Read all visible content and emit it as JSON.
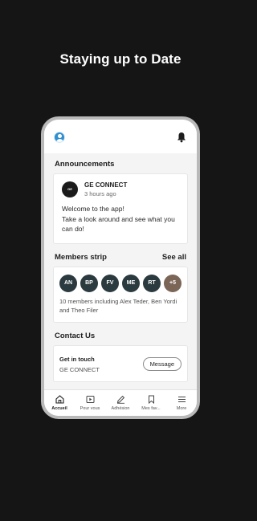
{
  "headline": "Staying up to Date",
  "topbar": {
    "avatar_icon": "user-avatar-icon",
    "notifications_icon": "bell-icon"
  },
  "announcements": {
    "title": "Announcements",
    "post": {
      "author": "GE CONNECT",
      "time": "3 hours ago",
      "line1": "Welcome to the app!",
      "line2": "Take a look around and see what you can do!",
      "logo_text": "GE CONNECT"
    }
  },
  "members": {
    "title": "Members strip",
    "see_all": "See all",
    "chips": [
      "AN",
      "BP",
      "FV",
      "ME",
      "RT",
      "+5"
    ],
    "summary": "10 members including Alex Teder, Ben Yordi and Theo Filer"
  },
  "contact": {
    "title": "Contact Us",
    "heading": "Get in touch",
    "org": "GE CONNECT",
    "button": "Message"
  },
  "tabs": [
    {
      "label": "Accueil",
      "icon": "home-icon",
      "active": true
    },
    {
      "label": "Pour vous",
      "icon": "play-icon",
      "active": false
    },
    {
      "label": "Adhésion",
      "icon": "pen-icon",
      "active": false
    },
    {
      "label": "Mes fav...",
      "icon": "bookmark-icon",
      "active": false
    },
    {
      "label": "More",
      "icon": "menu-icon",
      "active": false
    }
  ],
  "colors": {
    "background": "#151515",
    "chip": "#2b3a3f",
    "chip_more": "#7a6557",
    "avatar": "#2f8fd0"
  }
}
